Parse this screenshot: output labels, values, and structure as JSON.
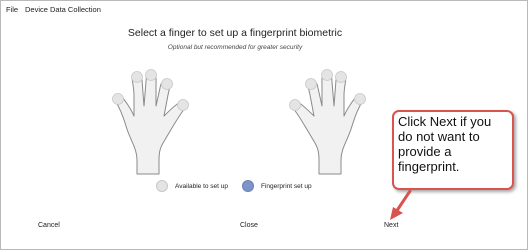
{
  "menu": {
    "file": "File",
    "device_data_collection": "Device Data Collection"
  },
  "heading": {
    "title": "Select a finger to set up a fingerprint biometric",
    "subtitle": "Optional but recommended for greater security"
  },
  "legend": {
    "available": "Available to set up",
    "set_up": "Fingerprint set up"
  },
  "buttons": {
    "cancel": "Cancel",
    "close": "Close",
    "next": "Next"
  },
  "callout": {
    "text": "Click Next if you do not want to provide a fingerprint."
  },
  "colors": {
    "available": "#e4e4e4",
    "fingerprint_set_up": "#7e93c8",
    "callout_border": "#d9534f",
    "hand_fill": "#f1f1f1",
    "hand_stroke": "#8a8a8a"
  }
}
